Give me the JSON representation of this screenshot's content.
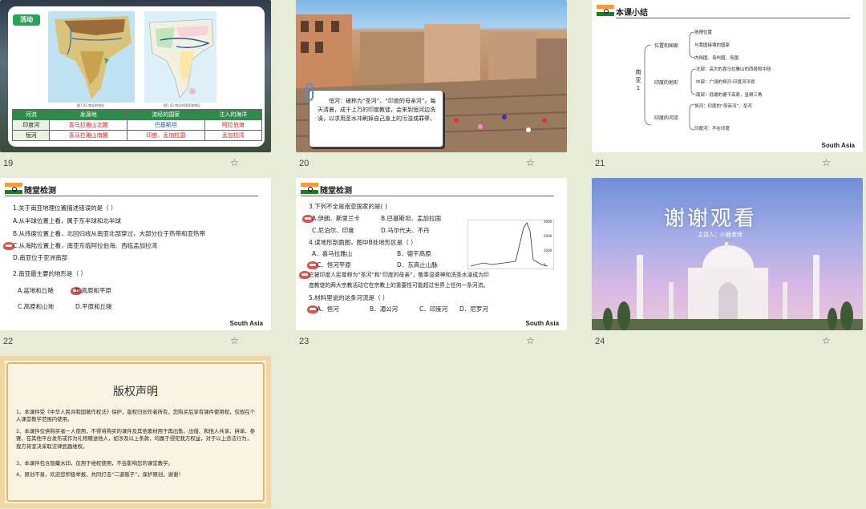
{
  "slides": [
    {
      "number": "19",
      "activity_label": "活动",
      "map1_caption": "图7.41  南亚的地形",
      "map2_caption": "图7.42  南亚的国家和地区",
      "table": {
        "headers": [
          "河流",
          "发源地",
          "流经的国家",
          "注入的海洋"
        ],
        "rows": [
          [
            "印度河",
            "喜马拉雅山北麓",
            "巴基斯坦",
            "阿拉伯海"
          ],
          [
            "恒河",
            "喜马拉雅山南麓",
            "印度、孟加拉国",
            "孟加拉湾"
          ]
        ]
      }
    },
    {
      "number": "20",
      "caption": "恒河：被称为“圣河”、“印度的母亲河”。每天清晨，成千上万的印度教徒，会来到恒河边洗澡，以求用圣水冲刷掉自己身上的污浊或罪孽。"
    },
    {
      "number": "21",
      "title": "本课小结",
      "root": [
        "南",
        "亚",
        "1"
      ],
      "groups": [
        {
          "label": "位置和国家",
          "items": [
            "地理位置",
            "与我国接壤的国家",
            "内陆国、岛屿国、岛国"
          ]
        },
        {
          "label": "印度的地形",
          "items": [
            "北部：高大的喜马拉雅山的西段和中段",
            "中部：广阔的恒河-印度河平原",
            "南部：低缓的德干高原，呈倒三角"
          ]
        },
        {
          "label": "印度的河流",
          "items": [
            "恒河：印度的“母亲河”、圣河",
            "印度河：不在印度"
          ]
        }
      ],
      "footer": "South Asia"
    },
    {
      "number": "22",
      "title": "随堂检测",
      "lines": [
        "1.关于南亚地理位置描述错误的是（       ）",
        "A.从半球位置上看，属于东半球和北半球",
        "B.从纬度位置上看，北回归线从南亚北部穿过，大部分位于热带和亚热带",
        "C.从海陆位置上看，南亚东临阿拉伯海、西临孟加拉湾",
        "D.南亚位于亚洲南部",
        "2.南亚最主要的地形是（       ）",
        "A.盆地和丘陵",
        "B.高原和平原",
        "C.高原和山地",
        "D.平原和丘陵"
      ],
      "footer": "South Asia"
    },
    {
      "number": "23",
      "title": "随堂检测",
      "lines": [
        "3.下列不全是南亚国家的是(      )",
        "A.伊朗、斯里兰卡",
        "B.巴基斯坦、孟加拉国",
        "C.尼泊尔、印度",
        "D.马尔代夫、不丹",
        "4.读地形剖面图，图中B处地形区是（    ）",
        "A．喜马拉雅山",
        "B．德干高原",
        "C．恒河平原",
        "D．东高止山脉",
        "它被印度人民尊称为“圣河”和“印度的母亲”，敬奉湿婆神和洗圣水澡成为印",
        "度教徒的两大宗教活动它在宗教上的重要性可能超过世界上任何一条河流。",
        "5.材料里说的这条河流是（    ）",
        "A．恒河",
        "B．湄公河",
        "C．印度河",
        "D．尼罗河"
      ],
      "chart_labels": [
        "3000",
        "2000",
        "1000",
        "0"
      ],
      "footer": "South Asia"
    },
    {
      "number": "24",
      "thanks": "谢谢观看",
      "presenter": "主讲人：小鹿老师"
    },
    {
      "title": "版权声明",
      "paragraphs": [
        "1、本课件受《中华人民共和国著作权法》保护，版权归创作者所有，您购买后享有课件使用权，仅限在个人课堂教学范围内使用。",
        "2、本课件仅供购买者一人使用，不得将购买的课件及其他素材用于再出售、出借、和他人共享、拼单、参赛、在其他平台发布或作为礼物赠送他人，如涉及以上条款，均属于侵犯我方权益，对于以上违法行为，我方将坚决采取法律武器维权。",
        "3、本课件包含隐藏水印，仅用于维权使用，不会影响您的课堂教学。",
        "4、原创不易，欢迎您积极举报，共同打击“二道贩子”，保护原创，谢谢！"
      ]
    }
  ],
  "icons": {
    "star": "star-icon"
  }
}
